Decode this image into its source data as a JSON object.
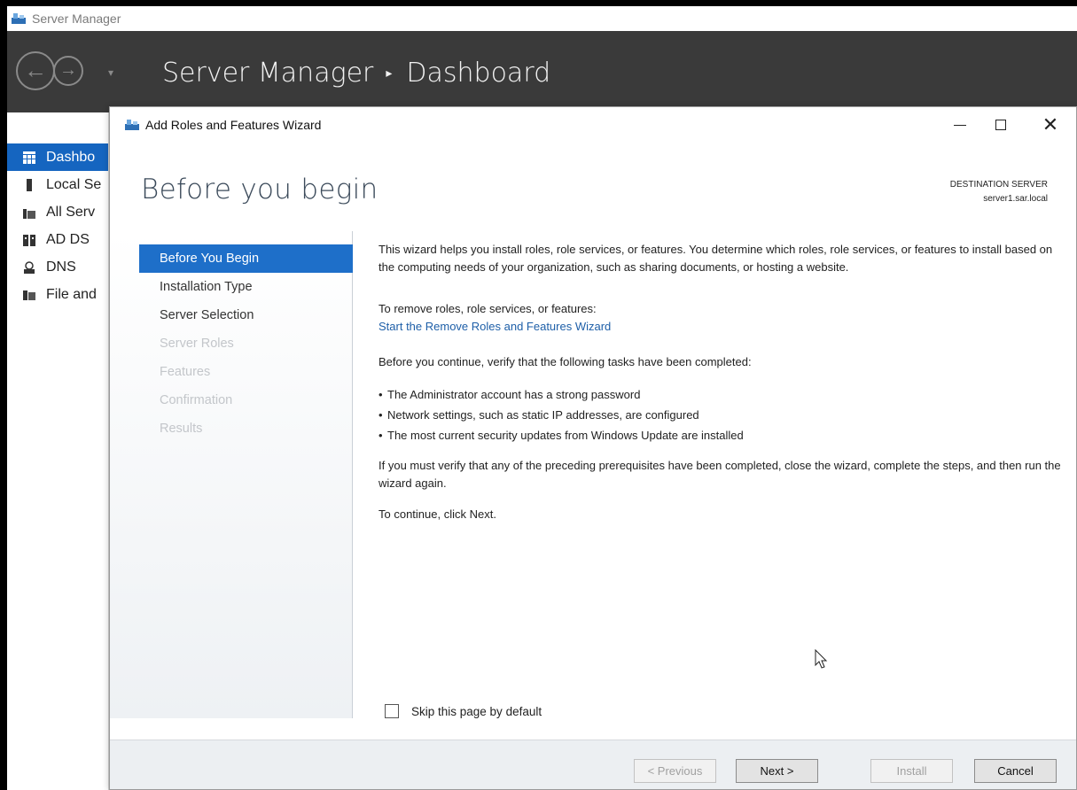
{
  "server_manager": {
    "window_title": "Server Manager",
    "breadcrumb": {
      "root": "Server Manager",
      "separator": "▸",
      "current": "Dashboard"
    },
    "sidebar": [
      {
        "label": "Dashbo",
        "icon": "dashboard-icon",
        "active": true
      },
      {
        "label": "Local Se",
        "icon": "server-icon",
        "active": false
      },
      {
        "label": "All Serv",
        "icon": "servers-icon",
        "active": false
      },
      {
        "label": "AD DS",
        "icon": "ad-ds-icon",
        "active": false
      },
      {
        "label": "DNS",
        "icon": "dns-icon",
        "active": false
      },
      {
        "label": "File and",
        "icon": "file-services-icon",
        "active": false
      }
    ]
  },
  "wizard": {
    "title": "Add Roles and Features Wizard",
    "heading": "Before you begin",
    "destination": {
      "label": "DESTINATION SERVER",
      "server": "server1.sar.local"
    },
    "steps": [
      {
        "label": "Before You Begin",
        "state": "active"
      },
      {
        "label": "Installation Type",
        "state": "enabled"
      },
      {
        "label": "Server Selection",
        "state": "enabled"
      },
      {
        "label": "Server Roles",
        "state": "disabled"
      },
      {
        "label": "Features",
        "state": "disabled"
      },
      {
        "label": "Confirmation",
        "state": "disabled"
      },
      {
        "label": "Results",
        "state": "disabled"
      }
    ],
    "content": {
      "intro": "This wizard helps you install roles, role services, or features. You determine which roles, role services, or features to install based on the computing needs of your organization, such as sharing documents, or hosting a website.",
      "remove_text": "To remove roles, role services, or features:",
      "remove_link": "Start the Remove Roles and Features Wizard",
      "verify_text": "Before you continue, verify that the following tasks have been completed:",
      "bullets": [
        "The Administrator account has a strong password",
        "Network settings, such as static IP addresses, are configured",
        "The most current security updates from Windows Update are installed"
      ],
      "prereq_text": "If you must verify that any of the preceding prerequisites have been completed, close the wizard, complete the steps, and then run the wizard again.",
      "continue_text": "To continue, click Next."
    },
    "skip_label": "Skip this page by default",
    "skip_checked": false,
    "buttons": {
      "previous": "< Previous",
      "next": "Next >",
      "install": "Install",
      "cancel": "Cancel"
    },
    "accent_color": "#1e6fc9"
  }
}
